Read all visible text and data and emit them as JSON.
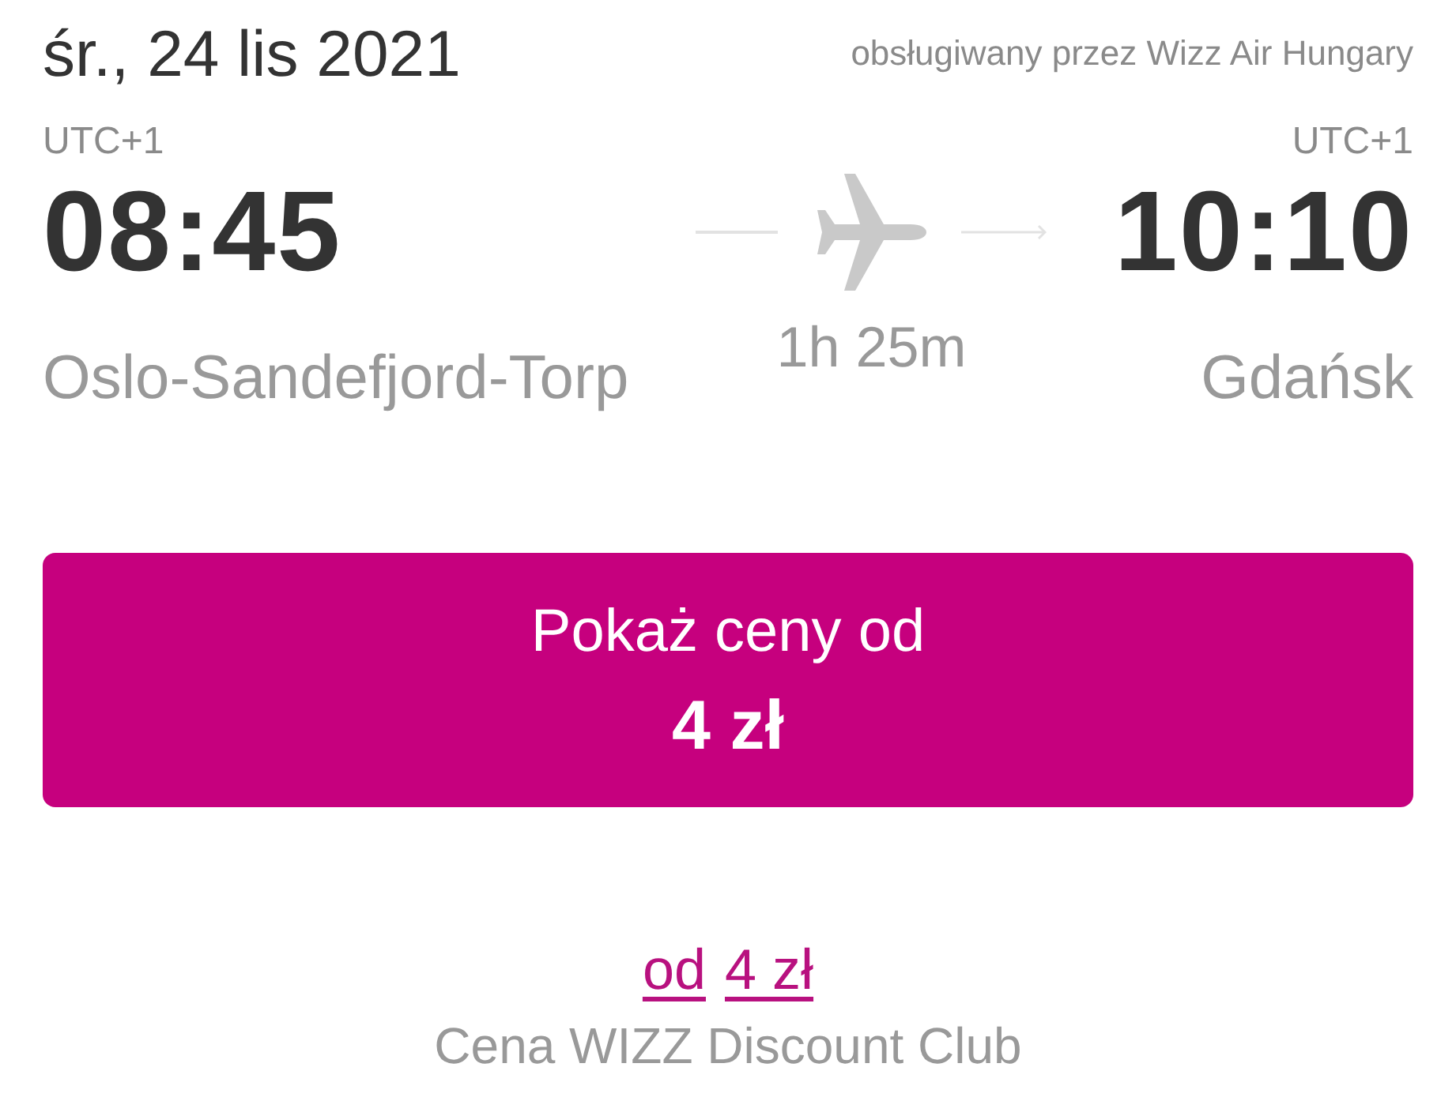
{
  "flight": {
    "date": "śr., 24 lis 2021",
    "operator": "obsługiwany przez Wizz Air Hungary",
    "departure": {
      "timezone": "UTC+1",
      "time": "08:45",
      "airport": "Oslo-Sandefjord-Torp"
    },
    "duration": "1h 25m",
    "arrival": {
      "timezone": "UTC+1",
      "time": "10:10",
      "airport": "Gdańsk"
    }
  },
  "price_button": {
    "label": "Pokaż ceny od",
    "price": "4 zł"
  },
  "discount_price": {
    "links": [
      "od",
      "4 zł"
    ],
    "caption": "Cena WIZZ Discount Club"
  }
}
